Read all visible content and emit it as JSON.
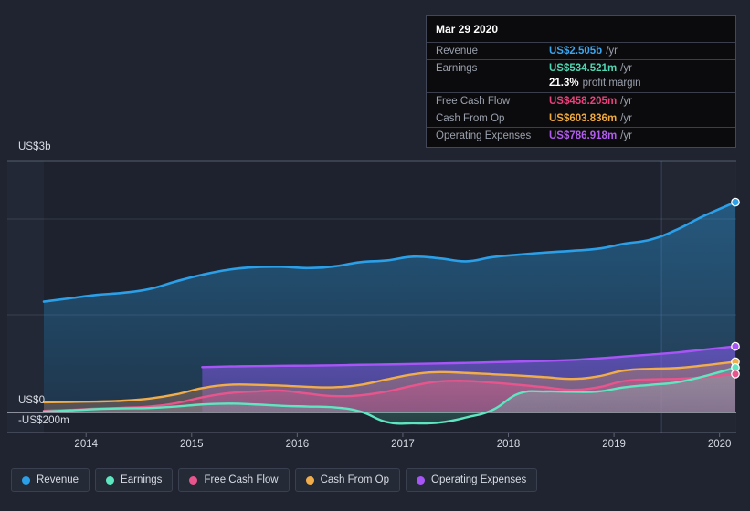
{
  "tooltip": {
    "title": "Mar 29 2020",
    "rows": [
      {
        "label": "Revenue",
        "value": "US$2.505b",
        "unit": "/yr",
        "color_key": "revenue"
      },
      {
        "label": "Earnings",
        "value": "US$534.521m",
        "unit": "/yr",
        "color_key": "earnings"
      },
      {
        "label": "",
        "value": "21.3%",
        "unit": "profit margin",
        "color_key": "margin"
      },
      {
        "label": "Free Cash Flow",
        "value": "US$458.205m",
        "unit": "/yr",
        "color_key": "fcf"
      },
      {
        "label": "Cash From Op",
        "value": "US$603.836m",
        "unit": "/yr",
        "color_key": "cfo"
      },
      {
        "label": "Operating Expenses",
        "value": "US$786.918m",
        "unit": "/yr",
        "color_key": "opex"
      }
    ]
  },
  "legend": {
    "items": [
      {
        "label": "Revenue",
        "color": "#2b9fe8"
      },
      {
        "label": "Earnings",
        "color": "#5ee6c0"
      },
      {
        "label": "Free Cash Flow",
        "color": "#e8558c"
      },
      {
        "label": "Cash From Op",
        "color": "#f0ad4a"
      },
      {
        "label": "Operating Expenses",
        "color": "#a855f7"
      }
    ]
  },
  "axes": {
    "y_labels": [
      "US$3b",
      "US$0",
      "-US$200m"
    ],
    "x_labels": [
      "2014",
      "2015",
      "2016",
      "2017",
      "2018",
      "2019",
      "2020"
    ]
  },
  "chart_data": {
    "type": "area",
    "title": "",
    "xlabel": "",
    "ylabel": "",
    "ylim": [
      -200000000,
      3000000000
    ],
    "y_tick_labels": [
      "US$3b",
      "US$0",
      "-US$200m"
    ],
    "x_tick_labels": [
      "2014",
      "2015",
      "2016",
      "2017",
      "2018",
      "2019",
      "2020"
    ],
    "grid": true,
    "legend_position": "bottom",
    "forecast_divider_year": 2019.45,
    "x": [
      2013.6,
      2013.85,
      2014.1,
      2014.35,
      2014.6,
      2014.85,
      2015.1,
      2015.35,
      2015.6,
      2015.85,
      2016.1,
      2016.35,
      2016.6,
      2016.85,
      2017.1,
      2017.35,
      2017.6,
      2017.85,
      2018.1,
      2018.35,
      2018.6,
      2018.85,
      2019.1,
      2019.35,
      2019.6,
      2019.85,
      2020.15
    ],
    "series": [
      {
        "name": "Revenue",
        "color": "#2b9fe8",
        "units": "US$",
        "values": [
          1320000000,
          1360000000,
          1400000000,
          1425000000,
          1470000000,
          1560000000,
          1640000000,
          1700000000,
          1730000000,
          1735000000,
          1720000000,
          1740000000,
          1790000000,
          1810000000,
          1855000000,
          1835000000,
          1800000000,
          1850000000,
          1880000000,
          1905000000,
          1925000000,
          1950000000,
          2010000000,
          2060000000,
          2180000000,
          2340000000,
          2505000000
        ],
        "end_value_label": "US$2.505b"
      },
      {
        "name": "Earnings",
        "color": "#5ee6c0",
        "units": "US$",
        "values": [
          10000000,
          25000000,
          40000000,
          48000000,
          52000000,
          70000000,
          95000000,
          105000000,
          95000000,
          80000000,
          70000000,
          60000000,
          10000000,
          -115000000,
          -130000000,
          -120000000,
          -60000000,
          30000000,
          225000000,
          250000000,
          245000000,
          250000000,
          300000000,
          330000000,
          360000000,
          430000000,
          534521000
        ],
        "end_value_label": "US$534.521m"
      },
      {
        "name": "Free Cash Flow",
        "color": "#e8558c",
        "units": "US$",
        "values": [
          20000000,
          30000000,
          45000000,
          55000000,
          70000000,
          110000000,
          180000000,
          230000000,
          250000000,
          260000000,
          225000000,
          195000000,
          205000000,
          250000000,
          320000000,
          370000000,
          375000000,
          355000000,
          330000000,
          300000000,
          270000000,
          300000000,
          375000000,
          395000000,
          400000000,
          420000000,
          458205000
        ],
        "end_value_label": "US$458.205m"
      },
      {
        "name": "Cash From Op",
        "color": "#f0ad4a",
        "units": "US$",
        "values": [
          120000000,
          125000000,
          130000000,
          140000000,
          165000000,
          215000000,
          290000000,
          330000000,
          330000000,
          320000000,
          305000000,
          300000000,
          330000000,
          395000000,
          455000000,
          480000000,
          470000000,
          455000000,
          440000000,
          420000000,
          400000000,
          430000000,
          500000000,
          520000000,
          530000000,
          560000000,
          603836000
        ],
        "end_value_label": "US$603.836m"
      },
      {
        "name": "Operating Expenses",
        "color": "#a855f7",
        "units": "US$",
        "values": [
          null,
          null,
          null,
          null,
          null,
          null,
          540000000,
          548000000,
          552000000,
          556000000,
          558000000,
          562000000,
          568000000,
          572000000,
          578000000,
          584000000,
          590000000,
          598000000,
          606000000,
          614000000,
          626000000,
          644000000,
          668000000,
          690000000,
          714000000,
          748000000,
          786918000
        ],
        "end_value_label": "US$786.918m"
      }
    ]
  }
}
